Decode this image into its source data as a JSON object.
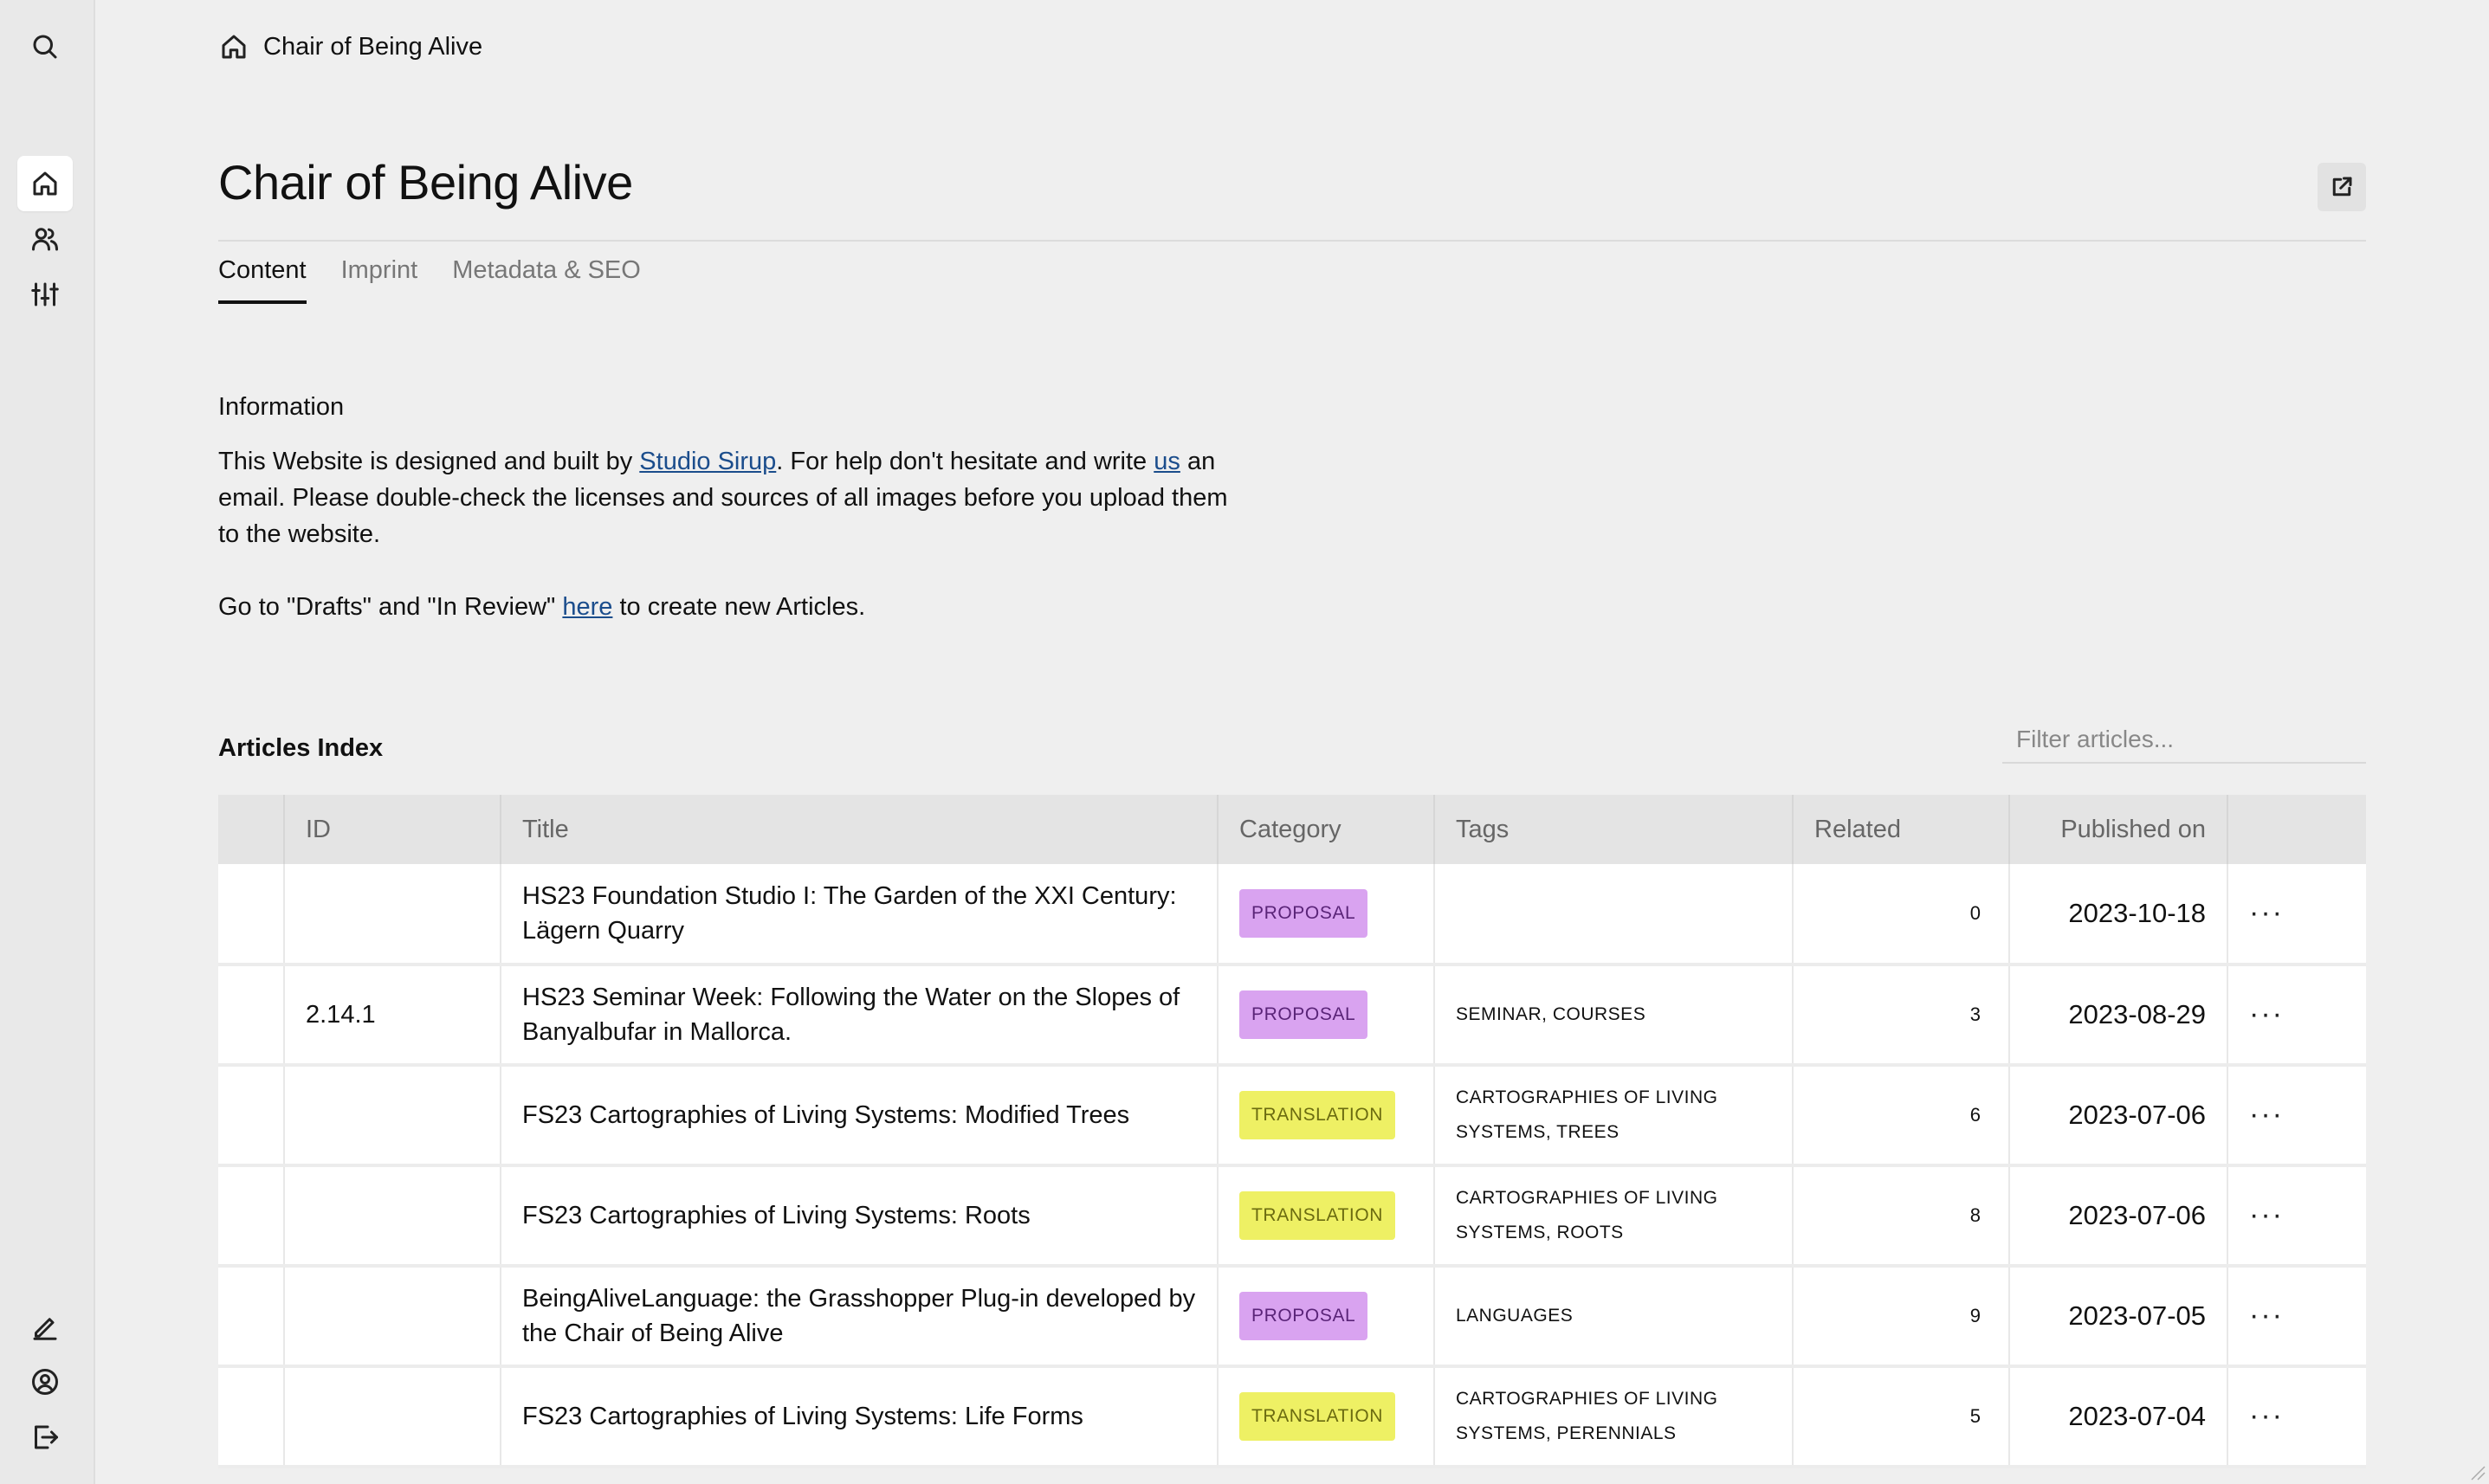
{
  "sidebar": {
    "top_icon": "search-icon",
    "items": [
      {
        "icon": "home-icon",
        "active": true
      },
      {
        "icon": "users-icon",
        "active": false
      },
      {
        "icon": "sliders-icon",
        "active": false
      }
    ],
    "bottom_items": [
      {
        "icon": "edit-icon"
      },
      {
        "icon": "account-icon"
      },
      {
        "icon": "logout-icon"
      }
    ]
  },
  "breadcrumb": {
    "icon": "home-icon",
    "label": "Chair of Being Alive"
  },
  "page": {
    "title": "Chair of Being Alive",
    "external_icon": "external-link-icon"
  },
  "tabs": [
    {
      "label": "Content",
      "active": true
    },
    {
      "label": "Imprint",
      "active": false
    },
    {
      "label": "Metadata & SEO",
      "active": false
    }
  ],
  "information": {
    "heading": "Information",
    "p1_part1": "This Website is designed and built by ",
    "p1_link1": "Studio Sirup",
    "p1_part2": ". For help don't hesitate and write ",
    "p1_link2": "us",
    "p1_part3": " an email. Please double-check the licenses and sources of all images before you upload them to the website.",
    "p2_part1": "Go to \"Drafts\" and \"In Review\" ",
    "p2_link": "here",
    "p2_part2": " to create new Articles."
  },
  "articles": {
    "heading": "Articles Index",
    "filter_placeholder": "Filter articles...",
    "columns": {
      "id": "ID",
      "title": "Title",
      "category": "Category",
      "tags": "Tags",
      "related": "Related",
      "published": "Published on"
    },
    "rows": [
      {
        "id": "",
        "title": "HS23 Foundation Studio I: The Garden of the XXI Century: Lägern Quarry",
        "category": "PROPOSAL",
        "tags": "",
        "related": "0",
        "published": "2023-10-18"
      },
      {
        "id": "2.14.1",
        "title": "HS23 Seminar Week: Following the Water on the Slopes of Banyalbufar in Mallorca.",
        "category": "PROPOSAL",
        "tags": "SEMINAR, COURSES",
        "related": "3",
        "published": "2023-08-29"
      },
      {
        "id": "",
        "title": "FS23 Cartographies of Living Systems: Modified Trees",
        "category": "TRANSLATION",
        "tags": "CARTOGRAPHIES OF LIVING SYSTEMS, TREES",
        "related": "6",
        "published": "2023-07-06"
      },
      {
        "id": "",
        "title": "FS23 Cartographies of Living Systems: Roots",
        "category": "TRANSLATION",
        "tags": "CARTOGRAPHIES OF LIVING SYSTEMS, ROOTS",
        "related": "8",
        "published": "2023-07-06"
      },
      {
        "id": "",
        "title": "BeingAliveLanguage: the Grasshopper Plug-in developed by the Chair of Being Alive",
        "category": "PROPOSAL",
        "tags": "LANGUAGES",
        "related": "9",
        "published": "2023-07-05"
      },
      {
        "id": "",
        "title": "FS23 Cartographies of Living Systems: Life Forms",
        "category": "TRANSLATION",
        "tags": "CARTOGRAPHIES OF LIVING SYSTEMS, PERENNIALS",
        "related": "5",
        "published": "2023-07-04"
      }
    ],
    "more_label": "···"
  },
  "colors": {
    "proposal_bg": "#d9a3f0",
    "translation_bg": "#eef064",
    "link": "#1b4d8c"
  }
}
